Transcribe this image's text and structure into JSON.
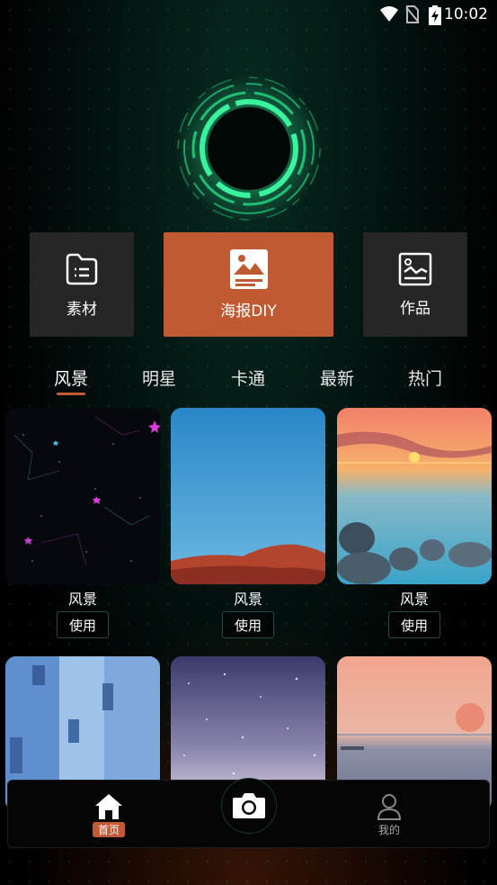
{
  "status_bar": {
    "time": "10:02",
    "icons": [
      "wifi-icon",
      "no-sim-icon",
      "battery-charging-icon"
    ]
  },
  "colors": {
    "accent": "#bf5a33",
    "card_dark": "#262626",
    "ring_green": "#2ee08a",
    "background": "#000000"
  },
  "actions": [
    {
      "label": "素材",
      "icon": "document-list-icon"
    },
    {
      "label": "海报DIY",
      "icon": "poster-image-icon"
    },
    {
      "label": "作品",
      "icon": "gallery-chart-icon"
    }
  ],
  "tabs": [
    {
      "label": "风景",
      "active": true
    },
    {
      "label": "明星",
      "active": false
    },
    {
      "label": "卡通",
      "active": false
    },
    {
      "label": "最新",
      "active": false
    },
    {
      "label": "热门",
      "active": false
    }
  ],
  "grid": {
    "items": [
      {
        "label": "风景",
        "button": "使用",
        "scene": "starry-constellation"
      },
      {
        "label": "风景",
        "button": "使用",
        "scene": "blue-sky-red-hill"
      },
      {
        "label": "风景",
        "button": "使用",
        "scene": "sunset-sea-rocks"
      },
      {
        "scene": "blue-alley"
      },
      {
        "scene": "purple-snow-sky"
      },
      {
        "scene": "pink-sunset-sea"
      }
    ]
  },
  "bottom_nav": {
    "home_label": "首页",
    "mine_label": "我的",
    "camera_icon": "camera-icon"
  }
}
